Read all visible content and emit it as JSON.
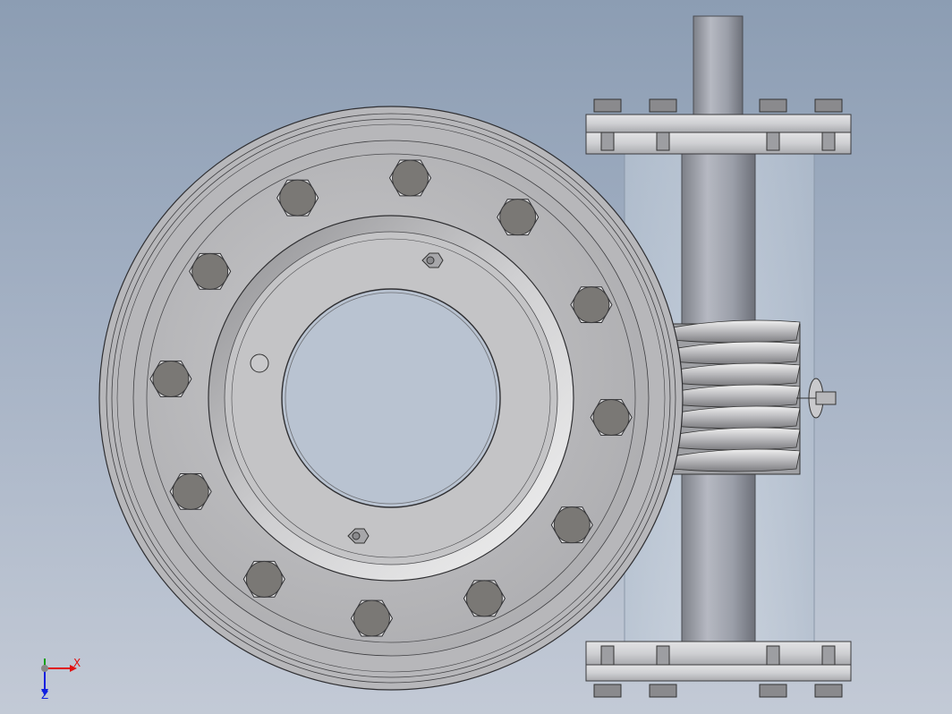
{
  "triad": {
    "x_label": "X",
    "y_label": "Y",
    "z_label": "Z",
    "x_color": "#e01010",
    "y_color": "#10a010",
    "z_color": "#1020e0"
  },
  "colors": {
    "metal_light": "#d4d4d6",
    "metal_mid": "#a8a9ad",
    "metal_dark": "#6e6f73",
    "bolt_head": "#7a7875",
    "glass": "#c6d2de"
  },
  "scene": {
    "gear_bolt_icons": [
      "hex-bolt-icon",
      "hex-bolt-icon",
      "hex-bolt-icon",
      "hex-bolt-icon",
      "hex-bolt-icon",
      "hex-bolt-icon",
      "hex-bolt-icon",
      "hex-bolt-icon",
      "hex-bolt-icon",
      "hex-bolt-icon",
      "hex-bolt-icon",
      "hex-bolt-icon"
    ],
    "flange_bolt_icons": [
      "hex-nut-icon",
      "hex-nut-icon",
      "hex-nut-icon",
      "hex-nut-icon"
    ]
  }
}
